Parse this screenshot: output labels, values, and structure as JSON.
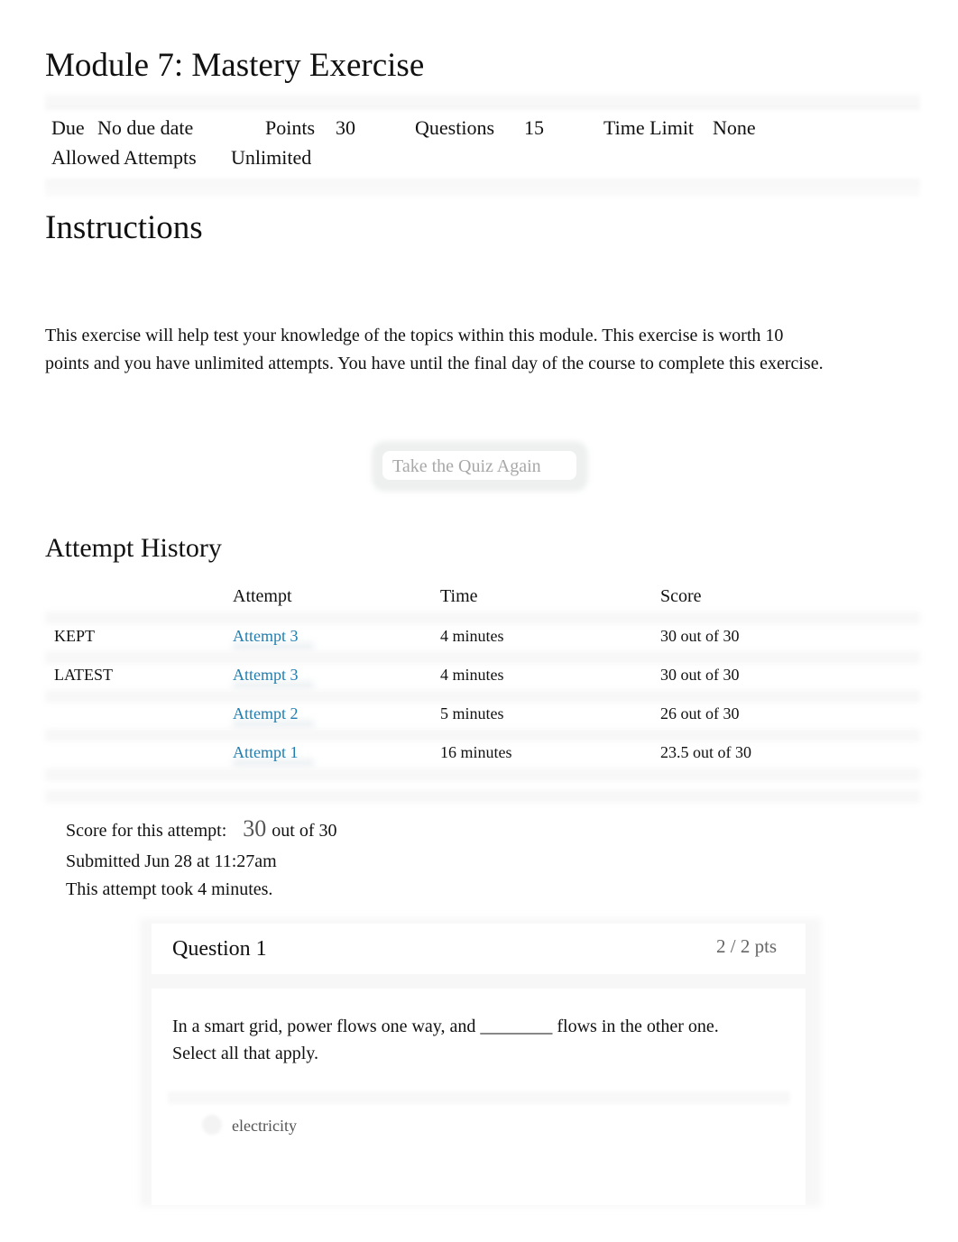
{
  "page": {
    "title": "Module 7: Mastery Exercise"
  },
  "details": {
    "due_label": "Due",
    "due_value": "No due date",
    "points_label": "Points",
    "points_value": "30",
    "questions_label": "Questions",
    "questions_value": "15",
    "time_limit_label": "Time Limit",
    "time_limit_value": "None",
    "allowed_attempts_label": "Allowed Attempts",
    "allowed_attempts_value": "Unlimited"
  },
  "instructions": {
    "heading": "Instructions",
    "text": "This exercise will help test your knowledge of the topics within this module. This exercise is worth 10 points and you have unlimited attempts. You have until the final day of the course to complete this exercise.",
    "retake_button": "Take the Quiz Again"
  },
  "attempt_history": {
    "heading": "Attempt History",
    "columns": [
      "",
      "Attempt",
      "Time",
      "Score"
    ],
    "rows": [
      {
        "status": "KEPT",
        "attempt": "Attempt 3",
        "time": "4 minutes",
        "score": "30 out of 30"
      },
      {
        "status": "LATEST",
        "attempt": "Attempt 3",
        "time": "4 minutes",
        "score": "30 out of 30"
      },
      {
        "status": "",
        "attempt": "Attempt 2",
        "time": "5 minutes",
        "score": "26 out of 30"
      },
      {
        "status": "",
        "attempt": "Attempt 1",
        "time": "16 minutes",
        "score": "23.5 out of 30"
      }
    ]
  },
  "attempt_summary": {
    "score_label": "Score for this attempt:",
    "score_value": "30",
    "score_total": "out of 30",
    "submitted": "Submitted Jun 28 at 11:27am",
    "duration": "This attempt took 4 minutes."
  },
  "question": {
    "title": "Question 1",
    "points": "2 / 2 pts",
    "text_line1": "In a smart grid, power flows one way, and ________ flows in the other one.",
    "text_line2": "Select all that apply.",
    "answers": [
      {
        "label": "electricity"
      }
    ]
  },
  "colors": {
    "link": "#1f7db0",
    "muted_text": "#a8a8a8"
  }
}
